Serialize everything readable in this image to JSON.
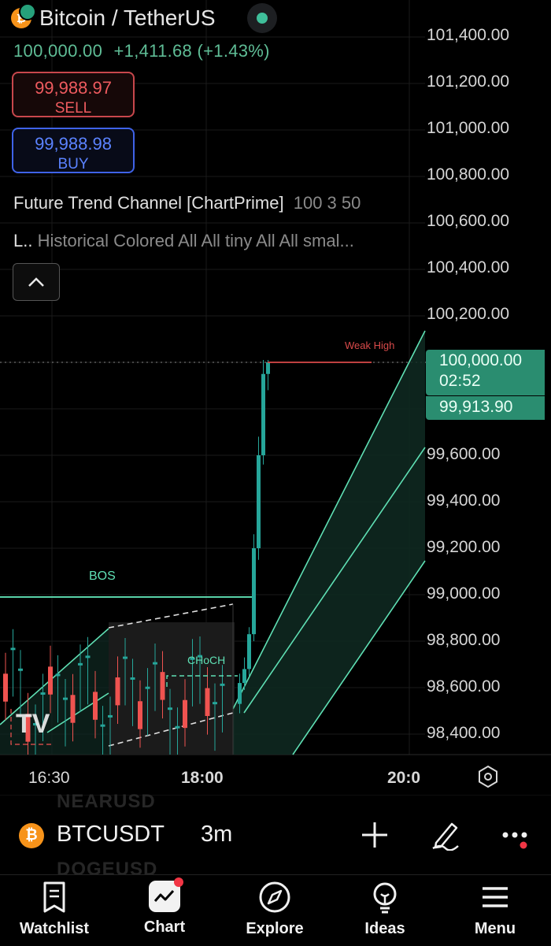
{
  "header": {
    "title": "Bitcoin / TetherUS",
    "coin_glyph": "₿",
    "price": "100,000.00",
    "change": "+1,411.68",
    "change_pct": "(+1.43%)",
    "sell_price": "99,988.97",
    "sell_label": "SELL",
    "buy_price": "99,988.98",
    "buy_label": "BUY"
  },
  "indicators": {
    "line1_name": "Future Trend Channel [ChartPrime]",
    "line1_params": "100 3 50",
    "line2_prefix": "L..",
    "line2_text": "Historical Colored All All tiny All All smal..."
  },
  "chart": {
    "annotations": {
      "bos": "BOS",
      "choch": "CHoCH",
      "weak_high": "Weak High"
    },
    "y_axis_labels": [
      "101,400.00",
      "101,200.00",
      "101,000.00",
      "100,800.00",
      "100,600.00",
      "100,400.00",
      "100,200.00",
      "99,600.00",
      "99,400.00",
      "99,200.00",
      "99,000.00",
      "98,800.00",
      "98,600.00",
      "98,400.00"
    ],
    "last_price_tag": "100,000.00",
    "countdown": "02:52",
    "secondary_tag": "99,913.90",
    "x_axis_labels": [
      "16:30",
      "18:00",
      "20:0"
    ],
    "watermark": "TV",
    "colors": {
      "up": "#26a69a",
      "down": "#ef5350",
      "channel": "#5fe0b4",
      "weak_high": "#d94a4a",
      "tag": "#2a8d70"
    }
  },
  "chart_data": {
    "type": "candlestick",
    "title": "",
    "xlabel": "",
    "ylabel": "",
    "ylim": [
      98300,
      101500
    ],
    "x_ticks": [
      "16:30",
      "18:00",
      "20:0"
    ],
    "visible_candles_close_sequence_note_free": [
      98520,
      98400,
      98650,
      98580,
      98700,
      98450,
      98600,
      98380,
      98550,
      98420,
      98480,
      98350,
      98500,
      98430,
      98560,
      98600,
      98650,
      98520,
      98480,
      98400,
      98560,
      98700,
      98900,
      99400,
      99650,
      99950,
      100000
    ],
    "series": [
      {
        "name": "BOS",
        "values": [
          98990
        ]
      },
      {
        "name": "Weak High",
        "values": [
          100000
        ]
      }
    ]
  },
  "symbol_bar": {
    "symbol": "BTCUSDT",
    "timeframe": "3m",
    "ghost_above": "NEARUSD",
    "ghost_below": "DOGEUSD",
    "icons": [
      "plus-icon",
      "pen-icon",
      "more-icon"
    ]
  },
  "nav": {
    "items": [
      {
        "label": "Watchlist",
        "icon": "watchlist-icon"
      },
      {
        "label": "Chart",
        "icon": "chart-icon"
      },
      {
        "label": "Explore",
        "icon": "compass-icon"
      },
      {
        "label": "Ideas",
        "icon": "lightbulb-icon"
      },
      {
        "label": "Menu",
        "icon": "menu-icon"
      }
    ]
  }
}
